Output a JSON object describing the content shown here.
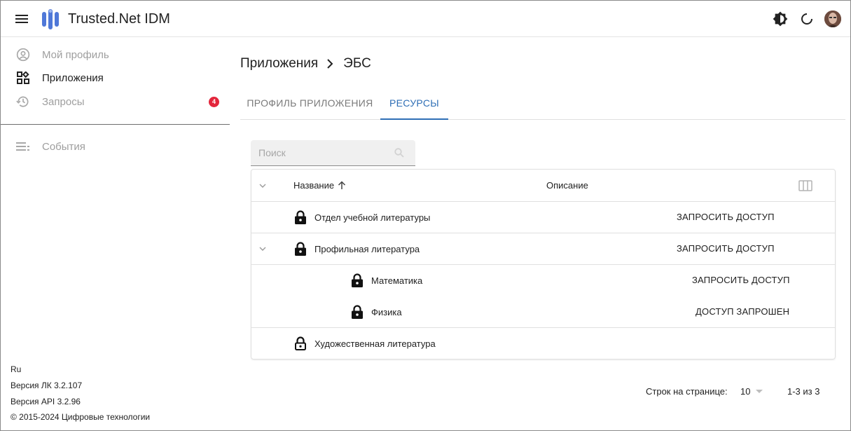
{
  "header": {
    "app_title": "Trusted.Net IDM",
    "icons": [
      "menu-icon",
      "theme-icon",
      "refresh-icon",
      "avatar"
    ]
  },
  "sidebar": {
    "items": [
      {
        "label": "Мой профиль",
        "icon": "account-circle-icon"
      },
      {
        "label": "Приложения",
        "icon": "apps-icon"
      },
      {
        "label": "Запросы",
        "icon": "history-icon",
        "badge": "4"
      },
      {
        "label": "События",
        "icon": "list-icon"
      }
    ],
    "footer": {
      "lang": "Ru",
      "lk_version": "Версия ЛК 3.2.107",
      "api_version": "Версия API 3.2.96",
      "copyright": "© 2015-2024 Цифровые технологии"
    }
  },
  "main": {
    "breadcrumb": {
      "parent": "Приложения",
      "current": "ЭБС"
    },
    "tabs": [
      {
        "label": "ПРОФИЛЬ ПРИЛОЖЕНИЯ"
      },
      {
        "label": "РЕСУРСЫ",
        "active": true
      }
    ],
    "search": {
      "placeholder": "Поиск"
    },
    "table": {
      "columns": {
        "name": "Название",
        "description": "Описание"
      },
      "rows": [
        {
          "name": "Отдел учебной литературы",
          "action": "ЗАПРОСИТЬ ДОСТУП",
          "locked": true
        },
        {
          "name": "Профильная литература",
          "action": "ЗАПРОСИТЬ ДОСТУП",
          "locked": true,
          "expanded": true,
          "children": [
            {
              "name": "Математика",
              "action": "ЗАПРОСИТЬ ДОСТУП",
              "locked": true
            },
            {
              "name": "Физика",
              "action": "ДОСТУП ЗАПРОШЕН",
              "locked": true
            }
          ]
        },
        {
          "name": "Художественная литература",
          "action": "",
          "locked": false
        }
      ]
    },
    "pagination": {
      "rows_label": "Строк на странице:",
      "rows_value": "10",
      "range": "1-3 из 3"
    }
  },
  "colors": {
    "accent": "#2f6fb6",
    "badge": "#e3263c",
    "logo": "#4f78d8"
  }
}
